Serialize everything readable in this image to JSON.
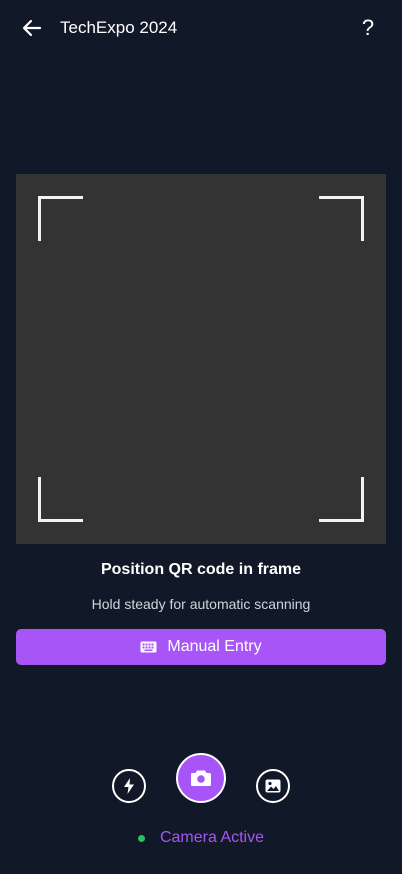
{
  "header": {
    "title": "TechExpo 2024",
    "help_label": "?"
  },
  "scanner": {
    "instruction_title": "Position QR code in frame",
    "instruction_subtitle": "Hold steady for automatic scanning"
  },
  "manual_entry": {
    "label": "Manual Entry",
    "icon": "keyboard-icon"
  },
  "controls": {
    "flash_icon": "flash-icon",
    "capture_icon": "camera-icon",
    "gallery_icon": "image-icon"
  },
  "status": {
    "text": "Camera Active",
    "dot_color": "#22c55e",
    "text_color": "#a855f7"
  },
  "colors": {
    "background": "#111827",
    "accent": "#a855f7",
    "viewfinder": "#333333"
  }
}
